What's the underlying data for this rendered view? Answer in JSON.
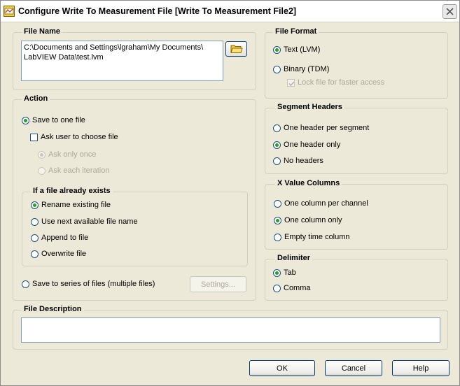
{
  "window": {
    "title": "Configure Write To Measurement File [Write To Measurement File2]"
  },
  "file_name": {
    "label": "File Name",
    "path_line1": "C:\\Documents and Settings\\lgraham\\My Documents\\",
    "path_line2": "LabVIEW Data\\test.lvm"
  },
  "action": {
    "label": "Action",
    "save_one": "Save to one file",
    "ask_user": "Ask user to choose file",
    "ask_once": "Ask only once",
    "ask_each": "Ask each iteration",
    "exists_label": "If a file already exists",
    "rename": "Rename existing file",
    "next_name": "Use next available file name",
    "append": "Append to file",
    "overwrite": "Overwrite file",
    "save_series": "Save to series of files (multiple files)",
    "settings_btn": "Settings..."
  },
  "file_format": {
    "label": "File Format",
    "text": "Text (LVM)",
    "binary": "Binary (TDM)",
    "lock": "Lock file for faster access"
  },
  "segment_headers": {
    "label": "Segment Headers",
    "per_segment": "One header per segment",
    "only": "One header only",
    "none": "No headers"
  },
  "x_value": {
    "label": "X Value Columns",
    "per_channel": "One column per channel",
    "only": "One column only",
    "empty": "Empty time column"
  },
  "delimiter": {
    "label": "Delimiter",
    "tab": "Tab",
    "comma": "Comma"
  },
  "file_description": {
    "label": "File Description",
    "value": ""
  },
  "buttons": {
    "ok": "OK",
    "cancel": "Cancel",
    "help": "Help"
  },
  "colors": {
    "radio_dot": "#21a121",
    "dialog_bg": "#ece9d8",
    "disabled_text": "#aca899"
  }
}
